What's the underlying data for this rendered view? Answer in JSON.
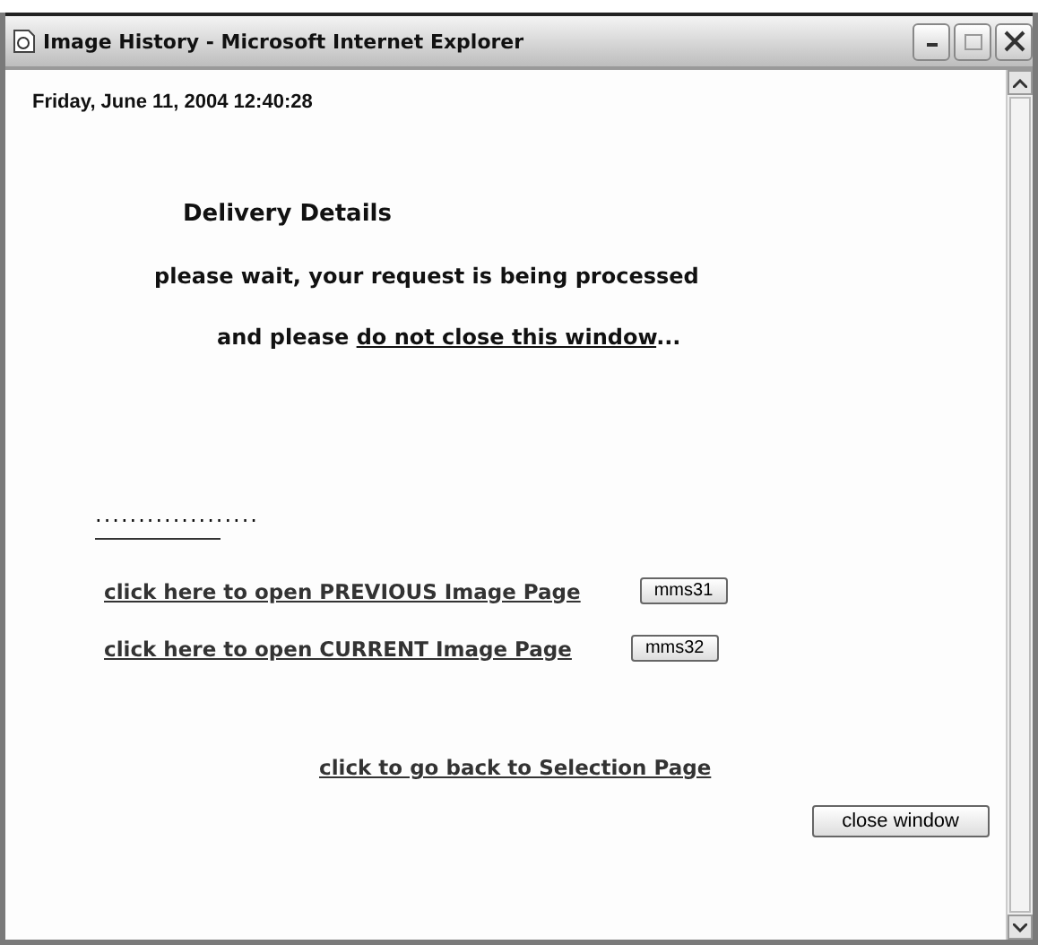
{
  "window": {
    "title": "Image History - Microsoft Internet Explorer"
  },
  "date": "Friday, June 11, 2004 12:40:28",
  "heading": "Delivery Details",
  "wait_message": "please wait, your request is being processed",
  "warning": {
    "before": "and please ",
    "link": "do not close this window",
    "after": "..."
  },
  "dots": "...................",
  "image_links": [
    {
      "label": "click here to open PREVIOUS Image Page",
      "button": "mms31"
    },
    {
      "label": "click here to open CURRENT Image Page",
      "button": "mms32"
    }
  ],
  "back_link": "click to go back to Selection Page",
  "close_button": "close window"
}
